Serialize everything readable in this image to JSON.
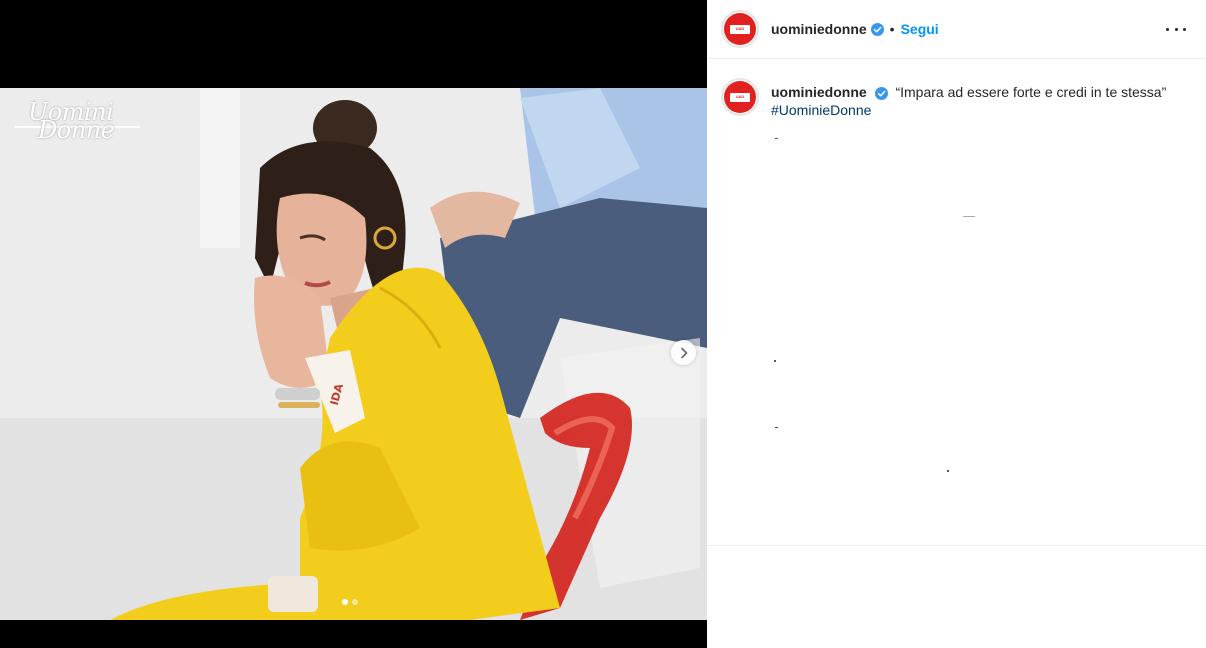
{
  "show_logo": {
    "line1": "Uomini",
    "line2": "Donne"
  },
  "sash_label": "IDA",
  "carousel": {
    "total_slides": 2,
    "active_slide": 1
  },
  "post": {
    "username": "uominiedonne",
    "verified": true,
    "separator": "•",
    "follow_label": "Segui",
    "more_icon": "more-options-icon"
  },
  "caption": {
    "username": "uominiedonne",
    "text": "“Impara ad essere forte e credi in te stessa”",
    "hashtag": "#UominieDonne"
  },
  "colors": {
    "brand_red": "#e0211f",
    "follow_blue": "#0095f6",
    "hashtag_blue": "#00376b",
    "verified_blue": "#3897f0",
    "jacket_yellow": "#f3cd1c"
  }
}
